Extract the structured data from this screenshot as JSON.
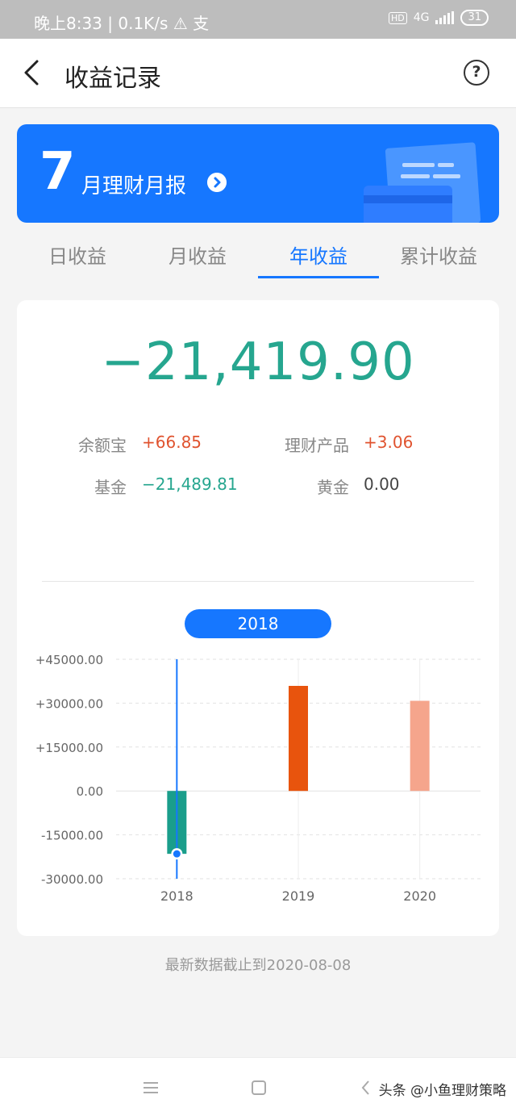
{
  "status": {
    "left": "晚上8:33 | 0.1K/s ⚠ 支",
    "hd": "HD",
    "network": "4G",
    "battery": "31"
  },
  "header": {
    "title": "收益记录"
  },
  "banner": {
    "month": "7",
    "text": "月理财月报"
  },
  "tabs": [
    "日收益",
    "月收益",
    "年收益",
    "累计收益"
  ],
  "active_tab": 2,
  "summary": {
    "total": "−21,419.90",
    "items": [
      {
        "label": "余额宝",
        "value": "+66.85",
        "color": "#e0532f"
      },
      {
        "label": "理财产品",
        "value": "+3.06",
        "color": "#e0532f"
      },
      {
        "label": "基金",
        "value": "−21,489.81",
        "color": "#26a68f"
      },
      {
        "label": "黄金",
        "value": "0.00",
        "color": "#444444"
      }
    ]
  },
  "selected_year": "2018",
  "chart_data": {
    "type": "bar",
    "categories": [
      "2018",
      "2019",
      "2020"
    ],
    "values": [
      -21489.81,
      35900,
      30800
    ],
    "colors": [
      "#1a9e8b",
      "#e8540d",
      "#f5a58c"
    ],
    "ylim": [
      -30000,
      45000
    ],
    "yticks": [
      "+45000.00",
      "+30000.00",
      "+15000.00",
      "0.00",
      "-15000.00",
      "-30000.00"
    ],
    "ytick_values": [
      45000,
      30000,
      15000,
      0,
      -15000,
      -30000
    ],
    "selected_index": 0,
    "grid": true
  },
  "footnote": "最新数据截止到2020-08-08",
  "watermark": "头条 @小鱼理财策略"
}
